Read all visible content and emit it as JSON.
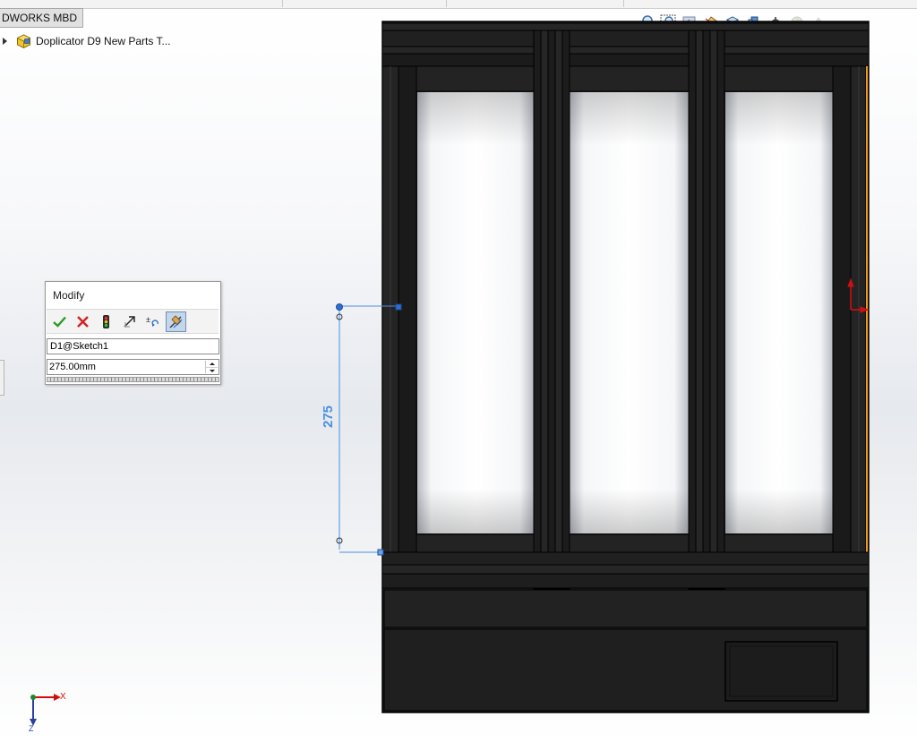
{
  "tab": {
    "label": "DWORKS MBD"
  },
  "tree": {
    "part_name": "Doplicator D9 New Parts T..."
  },
  "heads_up_toolbar": {
    "icons": [
      "zoom-to-fit-icon",
      "zoom-to-area-icon",
      "previous-view-icon",
      "section-view-icon",
      "view-orientation-icon",
      "display-style-icon",
      "hide-show-items-icon",
      "edit-appearance-icon",
      "apply-scene-icon",
      "view-settings-icon"
    ]
  },
  "modify_dialog": {
    "title": "Modify",
    "dimension_name": "D1@Sketch1",
    "value": "275.00mm",
    "buttons": [
      "ok-check-icon",
      "cancel-x-icon",
      "rebuild-traffic-light-icon",
      "reverse-direction-icon",
      "reset-spin-increment-icon",
      "mark-for-drawing-icon"
    ]
  },
  "dimension": {
    "text": "275"
  },
  "triad": {
    "x_label": "X",
    "z_label": "Z"
  },
  "colors": {
    "dimension_blue": "#4a90e2",
    "frame_black": "#1e1e1e",
    "selected_edge_orange": "#f39a1e",
    "ok_green": "#2a9a2a",
    "cancel_red": "#d42020"
  }
}
